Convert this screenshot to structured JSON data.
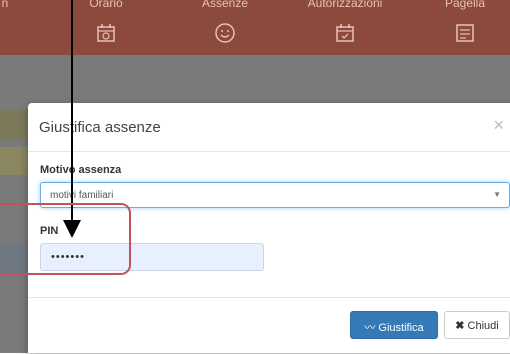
{
  "nav": {
    "items": [
      {
        "label": "n",
        "icon": "none"
      },
      {
        "label": "Orario",
        "icon": "calendar-clock-icon"
      },
      {
        "label": "Assenze",
        "icon": "smiley-icon"
      },
      {
        "label": "Autorizzazioni",
        "icon": "calendar-check-icon"
      },
      {
        "label": "Pagella",
        "icon": "report-card-icon"
      }
    ]
  },
  "modal": {
    "title": "Giustifica assenze",
    "close_symbol": "×",
    "reason_label": "Motivo assenza",
    "reason_value": "motivi familiari",
    "pin_label": "PIN",
    "pin_value": "•••••••",
    "justify_button": "Giustifica",
    "close_button": "Chiudi"
  },
  "colors": {
    "nav_bg": "#8b4a3b",
    "primary": "#337ab7",
    "annotation": "#c0545a"
  }
}
